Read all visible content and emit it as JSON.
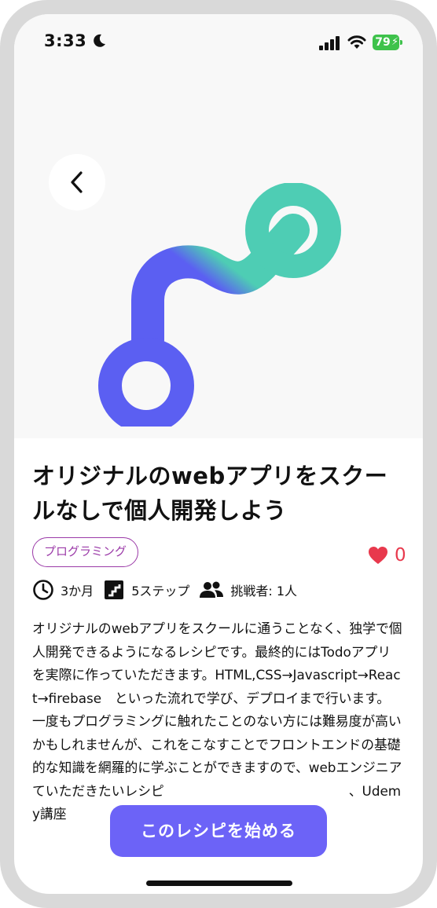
{
  "status_bar": {
    "time": "3:33",
    "battery": "79",
    "icons": [
      "moon-icon",
      "signal-icon",
      "wifi-icon",
      "battery-icon"
    ]
  },
  "header": {
    "back_icon": "chevron-left-icon"
  },
  "hero": {
    "image": "route-path-illustration"
  },
  "recipe": {
    "title": "オリジナルのwebアプリをスクールなしで個人開発しよう",
    "category": "プログラミング",
    "likes": "0",
    "meta": {
      "duration": "3か月",
      "steps": "5ステップ",
      "challengers": "挑戦者: 1人"
    },
    "description": "オリジナルのwebアプリをスクールに通うことなく、独学で個人開発できるようになるレシピです。最終的にはTodoアプリを実際に作っていただきます。HTML,CSS→Javascript→React→firebase　といった流れで学び、デプロイまで行います。 一度もプログラミングに触れたことのない方には難易度が高いかもしれませんが、これをこなすことでフロントエンドの基礎的な知識を網羅的に学ぶことができますので、webエンジニア　　　　　　　　　　　　　ていただきたいレシピ　　　　　　　　　　　　　　、Udemy講座"
  },
  "cta": {
    "label": "このレシピを始める"
  },
  "colors": {
    "accent": "#6c63f7",
    "chip": "#9b3aa8",
    "heart": "#e8394d",
    "gradient_start": "#5b5ff2",
    "gradient_end": "#4ecdb4"
  }
}
